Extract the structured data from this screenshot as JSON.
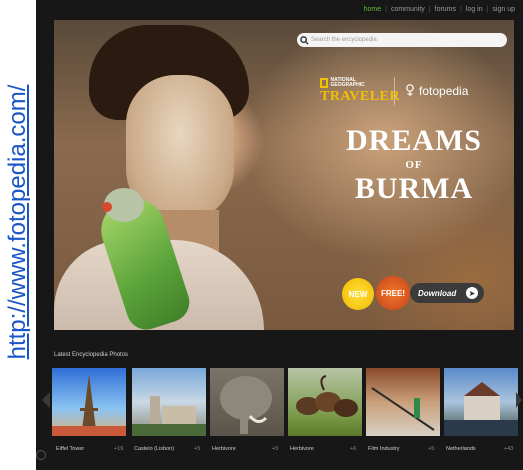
{
  "side_url": "http://www.fotopedia.com/",
  "topnav": [
    "home",
    "community",
    "forums",
    "log in",
    "sign up"
  ],
  "search": {
    "placeholder": "Search the encyclopedia"
  },
  "brand": {
    "ng_label": "NATIONAL GEOGRAPHIC",
    "traveler": "TRAVELER",
    "fotopedia": "fotopedia"
  },
  "hero": {
    "line1": "DREAMS",
    "line2": "OF",
    "line3": "BURMA"
  },
  "badges": {
    "new": "NEW",
    "free": "FREE!"
  },
  "download": {
    "label": "Download"
  },
  "photos": {
    "title": "Latest Encyclopedia Photos",
    "items": [
      {
        "caption": "Eiffel Tower",
        "count": "+19"
      },
      {
        "caption": "Castelo (Lisbon)",
        "count": "+5"
      },
      {
        "caption": "Herbivore",
        "count": "+5"
      },
      {
        "caption": "Herbivore",
        "count": "+6"
      },
      {
        "caption": "Film Industry",
        "count": "+5"
      },
      {
        "caption": "Netherlands",
        "count": "+43"
      }
    ]
  },
  "colors": {
    "active_nav": "#5cbc3c",
    "traveler": "#f2c100",
    "link": "#1a55c8"
  }
}
